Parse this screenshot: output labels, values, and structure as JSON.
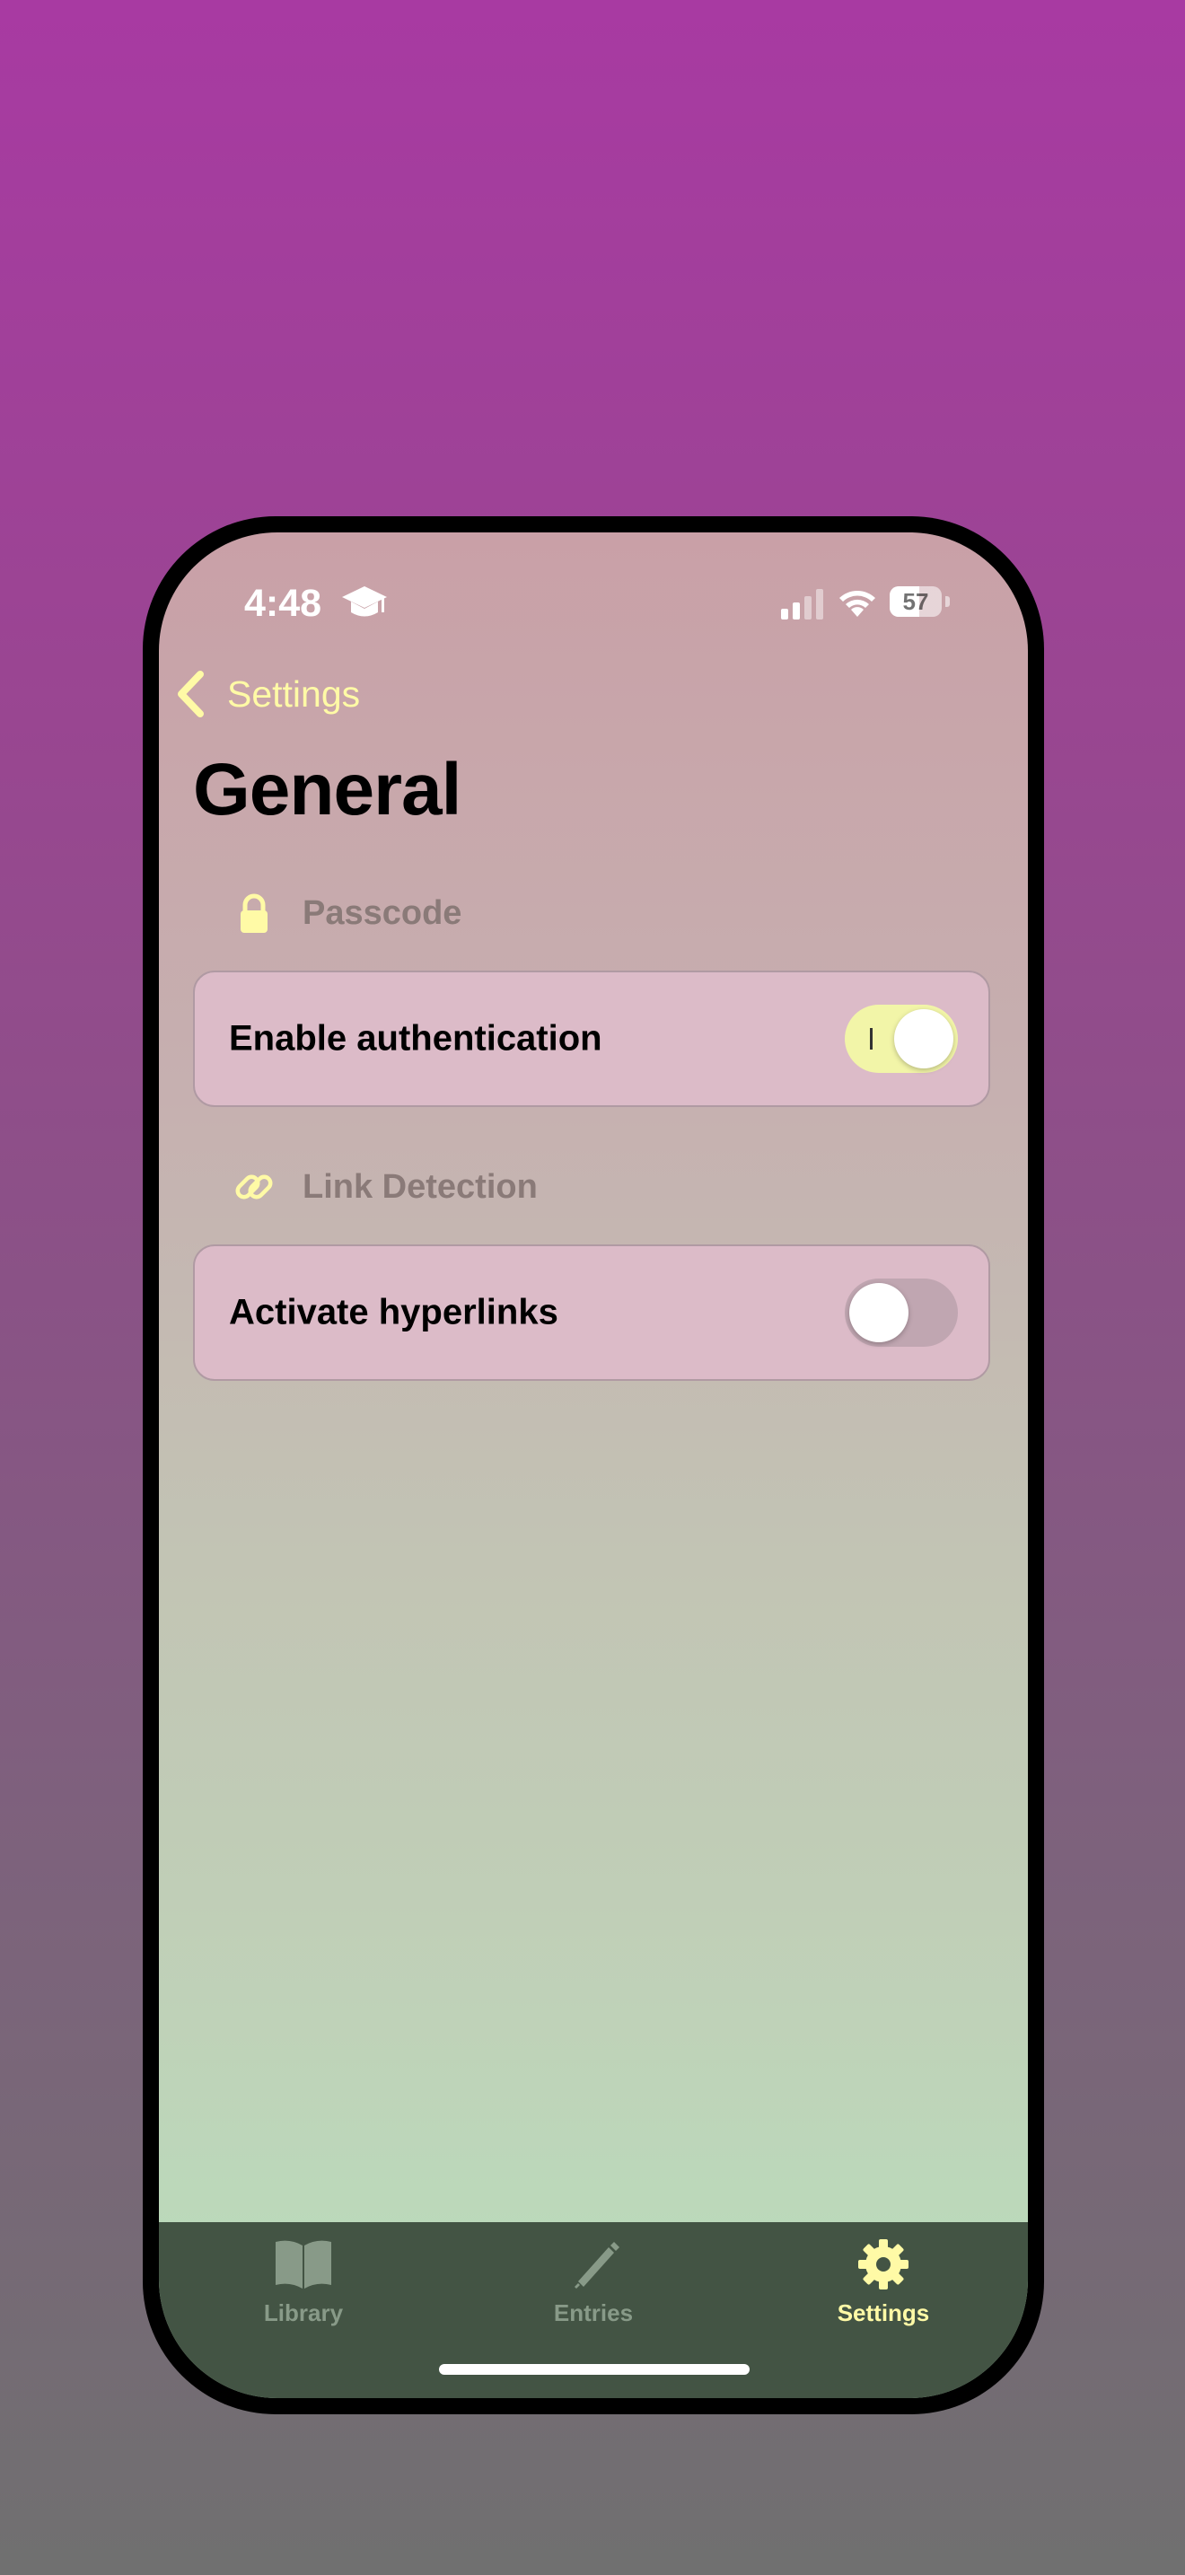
{
  "status_bar": {
    "time": "4:48",
    "status_icon": "graduation-cap-icon",
    "battery_percent": "57"
  },
  "nav": {
    "back_label": "Settings",
    "title": "General"
  },
  "sections": [
    {
      "header": "Passcode",
      "icon": "lock-icon",
      "row_label": "Enable authentication",
      "toggle_on": true
    },
    {
      "header": "Link Detection",
      "icon": "link-icon",
      "row_label": "Activate hyperlinks",
      "toggle_on": false
    }
  ],
  "tabbar": {
    "tabs": [
      {
        "label": "Library",
        "icon": "book-icon",
        "active": false
      },
      {
        "label": "Entries",
        "icon": "pencil-icon",
        "active": false
      },
      {
        "label": "Settings",
        "icon": "gear-icon",
        "active": true
      }
    ]
  },
  "colors": {
    "accent": "#fffaa6",
    "tabbar_bg": "#435444",
    "toggle_on": "#f2f5a8",
    "toggle_off": "#c0a6b1",
    "card_bg": "#dcbbc8"
  }
}
